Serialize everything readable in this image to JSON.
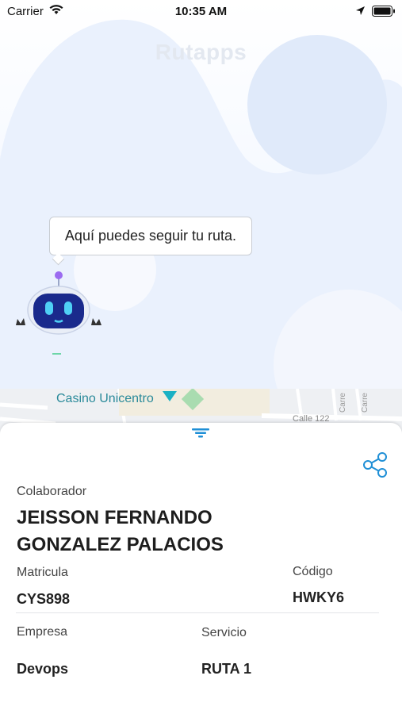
{
  "status_bar": {
    "carrier": "Carrier",
    "time": "10:35 AM"
  },
  "header": {
    "logo_text": "Rutapps"
  },
  "assistant": {
    "message": "Aquí puedes seguir tu ruta."
  },
  "map": {
    "place_label": "Casino Unicentro",
    "street_label": "Calle 122",
    "street_label_2": "Carre",
    "street_label_3": "Carre"
  },
  "details": {
    "collaborator_label": "Colaborador",
    "collaborator_name_line1": "JEISSON FERNANDO",
    "collaborator_name_line2": "GONZALEZ PALACIOS",
    "plate_label": "Matricula",
    "plate_value": "CYS898",
    "code_label": "Código",
    "code_value": "HWKY6",
    "company_label": "Empresa",
    "company_value": "Devops",
    "service_label": "Servicio",
    "service_value": "RUTA 1"
  },
  "colors": {
    "accent": "#1f8fd6",
    "blob": "#e6eefb",
    "robot_face": "#1a2a8c"
  }
}
